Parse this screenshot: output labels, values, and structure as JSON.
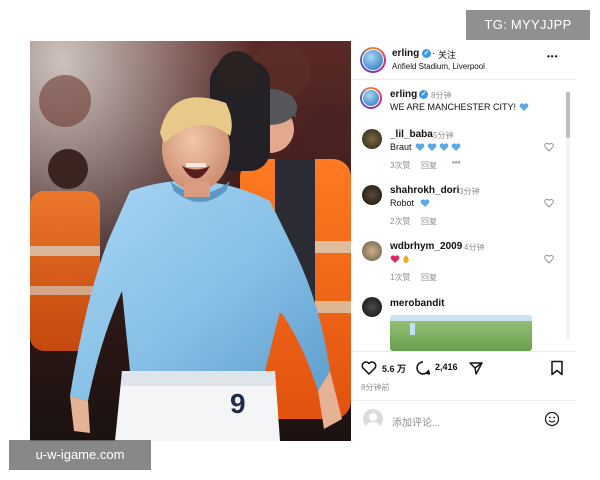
{
  "header": {
    "username": "erling",
    "follow_label": "关注",
    "location": "Anfield Stadium, Liverpool",
    "more_glyph": "•••",
    "verified_glyph": "✓"
  },
  "caption": {
    "username": "erling",
    "time": "8分钟",
    "text": "WE ARE MANCHESTER CITY!"
  },
  "comments": [
    {
      "username": "_lil_baba",
      "time": "5分钟",
      "text": "Braut",
      "likes": "3次赞",
      "reply": "回复",
      "more": "•••"
    },
    {
      "username": "shahrokh_dori",
      "time": "3分钟",
      "text": "Robot",
      "likes": "2次赞",
      "reply": "回复"
    },
    {
      "username": "wdbrhym_2009",
      "time": "4分钟",
      "text": "",
      "likes": "1次赞",
      "reply": "回复"
    },
    {
      "username": "merobandit"
    }
  ],
  "actions": {
    "like_count": "5.6 万",
    "comment_count": "2,416",
    "timestamp": "8分钟前",
    "comment_placeholder": "添加评论..."
  },
  "player": {
    "shirt_number": "9"
  },
  "overlays": {
    "tg_badge": "TG: MYYJJPP",
    "watermark": "u-w-igame.com"
  },
  "colors": {
    "verified": "#3897f0",
    "heart_blue": "#5aa9e6",
    "heart_red": "#e0245e",
    "city_blue": "#8ec3e6"
  },
  "icons": [
    "heart-icon",
    "comment-icon",
    "share-icon",
    "bookmark-icon",
    "emoji-icon",
    "more-icon",
    "verified-badge-icon"
  ]
}
